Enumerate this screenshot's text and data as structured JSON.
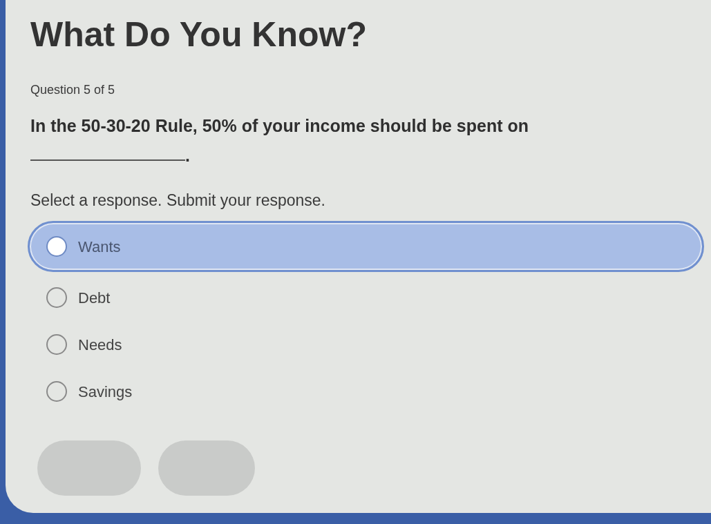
{
  "title": "What Do You Know?",
  "progress": "Question 5 of 5",
  "question": {
    "text": "In the 50-30-20 Rule, 50% of your income should be spent on",
    "end": "."
  },
  "instruction": "Select a response. Submit your response.",
  "options": [
    {
      "label": "Wants",
      "selected": false,
      "highlighted": true
    },
    {
      "label": "Debt",
      "selected": false,
      "highlighted": false
    },
    {
      "label": "Needs",
      "selected": false,
      "highlighted": false
    },
    {
      "label": "Savings",
      "selected": false,
      "highlighted": false
    }
  ],
  "buttons": [
    {
      "disabled": true
    },
    {
      "disabled": true
    }
  ]
}
